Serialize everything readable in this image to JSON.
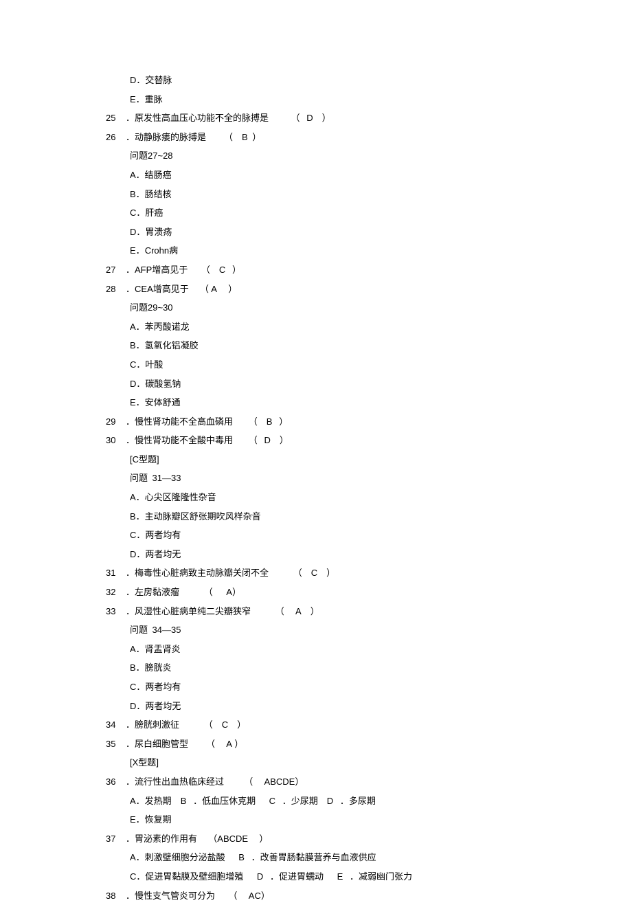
{
  "lines": [
    {
      "indent": "opt",
      "parts": [
        {
          "t": "latin",
          "v": "D"
        },
        {
          "t": "cn",
          "v": "．交替脉"
        }
      ]
    },
    {
      "indent": "opt",
      "parts": [
        {
          "t": "latin",
          "v": "E"
        },
        {
          "t": "cn",
          "v": "．重脉"
        }
      ]
    },
    {
      "indent": "num",
      "n": "25",
      "parts": [
        {
          "t": "cn",
          "v": "．原发性高血压心功能不全的脉搏是"
        },
        {
          "t": "sp",
          "v": "          "
        },
        {
          "t": "cn",
          "v": "（"
        },
        {
          "t": "sp",
          "v": "   "
        },
        {
          "t": "latin",
          "v": "D"
        },
        {
          "t": "sp",
          "v": "    "
        },
        {
          "t": "cn",
          "v": "）"
        }
      ]
    },
    {
      "indent": "num",
      "n": "26",
      "parts": [
        {
          "t": "cn",
          "v": "．动静脉瘘的脉搏是"
        },
        {
          "t": "sp",
          "v": "        "
        },
        {
          "t": "cn",
          "v": "（"
        },
        {
          "t": "sp",
          "v": "    "
        },
        {
          "t": "latin",
          "v": "B"
        },
        {
          "t": "sp",
          "v": "  "
        },
        {
          "t": "cn",
          "v": "）"
        }
      ]
    },
    {
      "indent": "opt",
      "parts": [
        {
          "t": "cn",
          "v": "问题 "
        },
        {
          "t": "latin",
          "v": "27~28"
        }
      ]
    },
    {
      "indent": "opt",
      "parts": [
        {
          "t": "latin",
          "v": "A"
        },
        {
          "t": "cn",
          "v": "．结肠癌"
        }
      ]
    },
    {
      "indent": "opt",
      "parts": [
        {
          "t": "latin",
          "v": "B"
        },
        {
          "t": "cn",
          "v": "．肠结核"
        }
      ]
    },
    {
      "indent": "opt",
      "parts": [
        {
          "t": "latin",
          "v": "C"
        },
        {
          "t": "cn",
          "v": "．肝癌"
        }
      ]
    },
    {
      "indent": "opt",
      "parts": [
        {
          "t": "latin",
          "v": "D"
        },
        {
          "t": "cn",
          "v": "．胃溃疡"
        }
      ]
    },
    {
      "indent": "opt",
      "parts": [
        {
          "t": "latin",
          "v": "E"
        },
        {
          "t": "cn",
          "v": "． "
        },
        {
          "t": "latin",
          "v": "Crohn "
        },
        {
          "t": "cn",
          "v": "病"
        }
      ]
    },
    {
      "indent": "num",
      "n": "27",
      "parts": [
        {
          "t": "cn",
          "v": "．"
        },
        {
          "t": "latin",
          "v": "AFP "
        },
        {
          "t": "cn",
          "v": "增高见于"
        },
        {
          "t": "sp",
          "v": "      "
        },
        {
          "t": "cn",
          "v": "（"
        },
        {
          "t": "sp",
          "v": "    "
        },
        {
          "t": "latin",
          "v": "C"
        },
        {
          "t": "sp",
          "v": "   "
        },
        {
          "t": "cn",
          "v": "）"
        }
      ]
    },
    {
      "indent": "num",
      "n": "28",
      "parts": [
        {
          "t": "cn",
          "v": "．"
        },
        {
          "t": "latin",
          "v": "CEA "
        },
        {
          "t": "cn",
          "v": "增高见于"
        },
        {
          "t": "sp",
          "v": "     "
        },
        {
          "t": "cn",
          "v": "（"
        },
        {
          "t": "sp",
          "v": " "
        },
        {
          "t": "latin",
          "v": "A"
        },
        {
          "t": "sp",
          "v": "     "
        },
        {
          "t": "cn",
          "v": "）"
        }
      ]
    },
    {
      "indent": "opt",
      "parts": [
        {
          "t": "cn",
          "v": "问题 "
        },
        {
          "t": "latin",
          "v": "29~30"
        }
      ]
    },
    {
      "indent": "opt",
      "parts": [
        {
          "t": "latin",
          "v": "A"
        },
        {
          "t": "cn",
          "v": "．苯丙酸诺龙"
        }
      ]
    },
    {
      "indent": "opt",
      "parts": [
        {
          "t": "latin",
          "v": "B"
        },
        {
          "t": "cn",
          "v": "．氢氧化铝凝胶"
        }
      ]
    },
    {
      "indent": "opt",
      "parts": [
        {
          "t": "latin",
          "v": "C"
        },
        {
          "t": "cn",
          "v": "．叶酸"
        }
      ]
    },
    {
      "indent": "opt",
      "parts": [
        {
          "t": "latin",
          "v": "D"
        },
        {
          "t": "cn",
          "v": "．碳酸氢钠"
        }
      ]
    },
    {
      "indent": "opt",
      "parts": [
        {
          "t": "latin",
          "v": "E"
        },
        {
          "t": "cn",
          "v": "．安体舒通"
        }
      ]
    },
    {
      "indent": "num",
      "n": "29",
      "parts": [
        {
          "t": "cn",
          "v": "．慢性肾功能不全高血磷用"
        },
        {
          "t": "sp",
          "v": "       "
        },
        {
          "t": "cn",
          "v": "（"
        },
        {
          "t": "sp",
          "v": "    "
        },
        {
          "t": "latin",
          "v": "B"
        },
        {
          "t": "sp",
          "v": "   "
        },
        {
          "t": "cn",
          "v": "）"
        }
      ]
    },
    {
      "indent": "num",
      "n": "30",
      "parts": [
        {
          "t": "cn",
          "v": "．慢性肾功能不全酸中毒用"
        },
        {
          "t": "sp",
          "v": "       "
        },
        {
          "t": "cn",
          "v": "（"
        },
        {
          "t": "sp",
          "v": "   "
        },
        {
          "t": "latin",
          "v": "D"
        },
        {
          "t": "sp",
          "v": "    "
        },
        {
          "t": "cn",
          "v": "）"
        }
      ]
    },
    {
      "indent": "opt",
      "parts": [
        {
          "t": "latin",
          "v": "[C "
        },
        {
          "t": "cn",
          "v": "型题"
        },
        {
          "t": "latin",
          "v": "]"
        }
      ]
    },
    {
      "indent": "opt",
      "parts": [
        {
          "t": "cn",
          "v": "问题"
        },
        {
          "t": "sp",
          "v": "  "
        },
        {
          "t": "latin",
          "v": "31"
        },
        {
          "t": "cn",
          "v": "―"
        },
        {
          "t": "latin",
          "v": "33"
        }
      ]
    },
    {
      "indent": "opt",
      "parts": [
        {
          "t": "latin",
          "v": "A"
        },
        {
          "t": "cn",
          "v": "．心尖区隆隆性杂音"
        }
      ]
    },
    {
      "indent": "opt",
      "parts": [
        {
          "t": "latin",
          "v": "B"
        },
        {
          "t": "cn",
          "v": "．主动脉瓣区舒张期吹风样杂音"
        }
      ]
    },
    {
      "indent": "opt",
      "parts": [
        {
          "t": "latin",
          "v": "C"
        },
        {
          "t": "cn",
          "v": "．两者均有"
        }
      ]
    },
    {
      "indent": "opt",
      "parts": [
        {
          "t": "latin",
          "v": "D"
        },
        {
          "t": "cn",
          "v": "．两者均无"
        }
      ]
    },
    {
      "indent": "num",
      "n": "31",
      "parts": [
        {
          "t": "cn",
          "v": "．梅毒性心脏病致主动脉瓣关闭不全"
        },
        {
          "t": "sp",
          "v": "           "
        },
        {
          "t": "cn",
          "v": "（"
        },
        {
          "t": "sp",
          "v": "    "
        },
        {
          "t": "latin",
          "v": "C"
        },
        {
          "t": "sp",
          "v": "    "
        },
        {
          "t": "cn",
          "v": "）"
        }
      ]
    },
    {
      "indent": "num",
      "n": "32",
      "parts": [
        {
          "t": "cn",
          "v": "．左房黏液瘤"
        },
        {
          "t": "sp",
          "v": "           "
        },
        {
          "t": "cn",
          "v": "（"
        },
        {
          "t": "sp",
          "v": "      "
        },
        {
          "t": "latin",
          "v": "A"
        },
        {
          "t": "cn",
          "v": "）"
        }
      ]
    },
    {
      "indent": "num",
      "n": "33",
      "parts": [
        {
          "t": "cn",
          "v": "．风湿性心脏病单纯二尖瓣狭窄"
        },
        {
          "t": "sp",
          "v": "           "
        },
        {
          "t": "cn",
          "v": "（"
        },
        {
          "t": "sp",
          "v": "     "
        },
        {
          "t": "latin",
          "v": "A"
        },
        {
          "t": "sp",
          "v": "    "
        },
        {
          "t": "cn",
          "v": "）"
        }
      ]
    },
    {
      "indent": "opt",
      "parts": [
        {
          "t": "cn",
          "v": "问题"
        },
        {
          "t": "sp",
          "v": "  "
        },
        {
          "t": "latin",
          "v": "34"
        },
        {
          "t": "cn",
          "v": "―"
        },
        {
          "t": "latin",
          "v": "35"
        }
      ]
    },
    {
      "indent": "opt",
      "parts": [
        {
          "t": "latin",
          "v": "A"
        },
        {
          "t": "cn",
          "v": "．肾盂肾炎"
        }
      ]
    },
    {
      "indent": "opt",
      "parts": [
        {
          "t": "latin",
          "v": "B"
        },
        {
          "t": "cn",
          "v": "．膀胱炎"
        }
      ]
    },
    {
      "indent": "opt",
      "parts": [
        {
          "t": "latin",
          "v": "C"
        },
        {
          "t": "cn",
          "v": "．两者均有"
        }
      ]
    },
    {
      "indent": "opt",
      "parts": [
        {
          "t": "latin",
          "v": "D"
        },
        {
          "t": "cn",
          "v": "．两者均无"
        }
      ]
    },
    {
      "indent": "num",
      "n": "34",
      "parts": [
        {
          "t": "cn",
          "v": "．膀胱刺激征"
        },
        {
          "t": "sp",
          "v": "           "
        },
        {
          "t": "cn",
          "v": "（"
        },
        {
          "t": "sp",
          "v": "    "
        },
        {
          "t": "latin",
          "v": "C"
        },
        {
          "t": "sp",
          "v": "    "
        },
        {
          "t": "cn",
          "v": "）"
        }
      ]
    },
    {
      "indent": "num",
      "n": "35",
      "parts": [
        {
          "t": "cn",
          "v": "．尿白细胞管型"
        },
        {
          "t": "sp",
          "v": "        "
        },
        {
          "t": "cn",
          "v": "（"
        },
        {
          "t": "sp",
          "v": "     "
        },
        {
          "t": "latin",
          "v": "A"
        },
        {
          "t": "sp",
          "v": " "
        },
        {
          "t": "cn",
          "v": "）"
        }
      ]
    },
    {
      "indent": "opt",
      "parts": [
        {
          "t": "latin",
          "v": "[X "
        },
        {
          "t": "cn",
          "v": "型题"
        },
        {
          "t": "latin",
          "v": "]"
        }
      ]
    },
    {
      "indent": "num",
      "n": "36",
      "parts": [
        {
          "t": "cn",
          "v": "．流行性出血热临床经过"
        },
        {
          "t": "sp",
          "v": "         "
        },
        {
          "t": "cn",
          "v": "（"
        },
        {
          "t": "sp",
          "v": "     "
        },
        {
          "t": "latin",
          "v": "ABCDE "
        },
        {
          "t": "cn",
          "v": "）"
        }
      ]
    },
    {
      "indent": "opt",
      "parts": [
        {
          "t": "latin",
          "v": "A"
        },
        {
          "t": "cn",
          "v": "．发热期"
        },
        {
          "t": "sp",
          "v": "    "
        },
        {
          "t": "latin",
          "v": "B"
        },
        {
          "t": "sp",
          "v": "   "
        },
        {
          "t": "cn",
          "v": "．低血压休克期"
        },
        {
          "t": "sp",
          "v": "      "
        },
        {
          "t": "latin",
          "v": "C"
        },
        {
          "t": "sp",
          "v": "   "
        },
        {
          "t": "cn",
          "v": "．少尿期"
        },
        {
          "t": "sp",
          "v": "    "
        },
        {
          "t": "latin",
          "v": "D"
        },
        {
          "t": "sp",
          "v": "   "
        },
        {
          "t": "cn",
          "v": "．多尿期"
        }
      ]
    },
    {
      "indent": "opt",
      "parts": [
        {
          "t": "latin",
          "v": "E"
        },
        {
          "t": "cn",
          "v": "．恢复期"
        }
      ]
    },
    {
      "indent": "num",
      "n": "37",
      "parts": [
        {
          "t": "cn",
          "v": "．胃泌素的作用有"
        },
        {
          "t": "sp",
          "v": "     "
        },
        {
          "t": "cn",
          "v": "（"
        },
        {
          "t": "latin",
          "v": "ABCDE"
        },
        {
          "t": "sp",
          "v": "     "
        },
        {
          "t": "cn",
          "v": "）"
        }
      ]
    },
    {
      "indent": "opt",
      "parts": [
        {
          "t": "latin",
          "v": "A"
        },
        {
          "t": "cn",
          "v": "．刺激壁细胞分泌盐酸"
        },
        {
          "t": "sp",
          "v": "      "
        },
        {
          "t": "latin",
          "v": "B"
        },
        {
          "t": "sp",
          "v": "   "
        },
        {
          "t": "cn",
          "v": "．改善胃肠黏膜营养与血液供应"
        }
      ]
    },
    {
      "indent": "opt",
      "parts": [
        {
          "t": "latin",
          "v": "C"
        },
        {
          "t": "cn",
          "v": "．促进胃黏膜及壁细胞增殖"
        },
        {
          "t": "sp",
          "v": "      "
        },
        {
          "t": "latin",
          "v": "D"
        },
        {
          "t": "sp",
          "v": "   "
        },
        {
          "t": "cn",
          "v": "．促进胃蠕动"
        },
        {
          "t": "sp",
          "v": "      "
        },
        {
          "t": "latin",
          "v": "E"
        },
        {
          "t": "sp",
          "v": "   "
        },
        {
          "t": "cn",
          "v": "．减弱幽门张力"
        }
      ]
    },
    {
      "indent": "num",
      "n": "38",
      "parts": [
        {
          "t": "cn",
          "v": "．慢性支气管炎可分为"
        },
        {
          "t": "sp",
          "v": "      "
        },
        {
          "t": "cn",
          "v": "（"
        },
        {
          "t": "sp",
          "v": "     "
        },
        {
          "t": "latin",
          "v": "AC "
        },
        {
          "t": "cn",
          "v": "）"
        }
      ]
    }
  ]
}
